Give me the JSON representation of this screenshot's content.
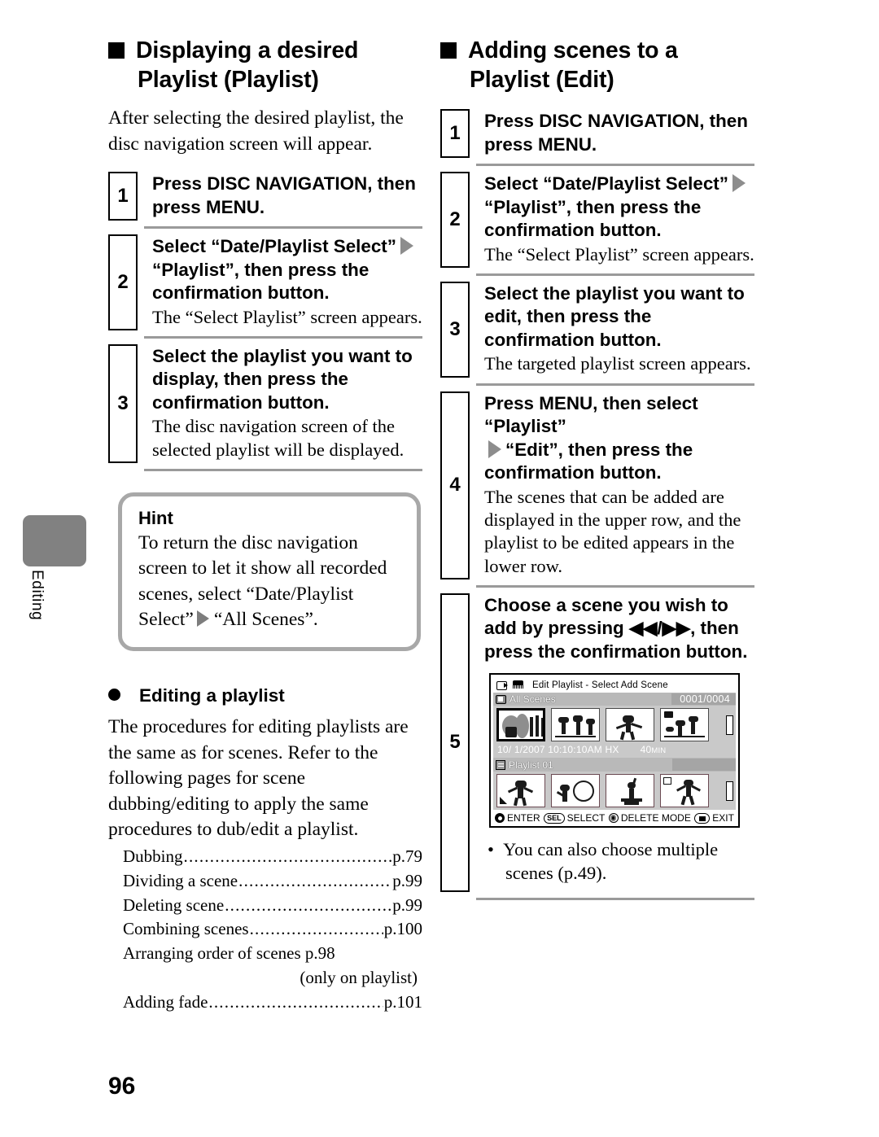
{
  "page": {
    "number": "96",
    "side_tab_label": "Editing"
  },
  "left_column": {
    "heading": "Displaying a desired Playlist (Playlist)",
    "intro": "After selecting the desired playlist, the disc navigation screen will appear.",
    "steps": [
      {
        "num": "1",
        "main_pre": "Press ",
        "main_bold": "DISC NAVIGATION",
        "main_mid": ", then press ",
        "main_bold2": "MENU",
        "main_post": ".",
        "sub": ""
      },
      {
        "num": "2",
        "main_pre": "Select “Date/Playlist Select”",
        "main_mid": "“Playlist”, then press the confirmation button.",
        "sub": "The “Select Playlist” screen appears."
      },
      {
        "num": "3",
        "main_pre": "Select the playlist you want to display, then press the confirmation button.",
        "sub": "The disc navigation screen of the selected playlist will be displayed."
      }
    ],
    "hint": {
      "title": "Hint",
      "text_before": "To return the disc navigation screen to let it show all recorded scenes, select “Date/Playlist Select”",
      "text_after": "“All Scenes”."
    },
    "subsection": {
      "heading": "Editing a playlist",
      "paragraph": "The procedures for editing playlists are the same as for scenes. Refer to the following pages for scene dubbing/editing to apply the same procedures to dub/edit a playlist.",
      "references": [
        {
          "label": "Dubbing",
          "page": "p.79"
        },
        {
          "label": "Dividing a scene",
          "page": "p.99"
        },
        {
          "label": "Deleting scene",
          "page": "p.99"
        },
        {
          "label": "Combining scenes",
          "page": "p.100"
        }
      ],
      "reference_plain": "Arranging order of scenes p.98",
      "reference_note": "(only on playlist)",
      "reference_last": {
        "label": "Adding fade",
        "page": "p.101"
      }
    }
  },
  "right_column": {
    "heading": "Adding scenes to a Playlist (Edit)",
    "steps": [
      {
        "num": "1",
        "main_pre": "Press ",
        "main_bold": "DISC NAVIGATION",
        "main_mid": ", then press ",
        "main_bold2": "MENU",
        "main_post": ".",
        "sub": ""
      },
      {
        "num": "2",
        "main_pre": "Select “Date/Playlist Select”",
        "main_mid": "“Playlist”, then press the confirmation button.",
        "sub": "The “Select Playlist” screen appears."
      },
      {
        "num": "3",
        "main_pre": "Select the playlist you want to edit, then press the confirmation button.",
        "sub": "The targeted playlist screen appears."
      },
      {
        "num": "4",
        "main_pre": "Press ",
        "main_bold": "MENU",
        "main_mid": ", then select “Playlist”",
        "main_post": "“Edit”, then press the confirmation button.",
        "sub": "The scenes that can be added are displayed in the upper row, and the playlist to be edited appears in the lower row."
      },
      {
        "num": "5",
        "main_pre": "Choose a scene you wish to add by pressing ",
        "glyph_rew": "◀◀",
        "glyph_sep": "/",
        "glyph_ff": "▶▶",
        "main_post": ", then press the confirmation button.",
        "note": "You can also choose multiple scenes (p.49)."
      }
    ],
    "lcd": {
      "title": "Edit  Playlist - Select Add Scene",
      "camera_icon": "camcorder-icon",
      "disc_icon": "disc-icon",
      "upper_row_label": "All Scenes",
      "counter": "0001/0004",
      "meta_date": "10/  1/2007",
      "meta_time": "10:10:10AM",
      "meta_quality": "HX",
      "meta_duration": "40",
      "meta_duration_unit": "MIN",
      "lower_row_label": "Playlist 01",
      "footer": [
        {
          "icon": "enter-button-icon",
          "label": "ENTER"
        },
        {
          "icon": "sel-button-icon",
          "label": "SELECT"
        },
        {
          "icon": "delete-mode-icon",
          "label": "DELETE MODE"
        },
        {
          "icon": "exit-button-icon",
          "label": "EXIT"
        }
      ]
    }
  },
  "colors": {
    "rule_gray": "#9a9a9a",
    "hint_border_gray": "#a8a8a8",
    "tab_gray": "#818181",
    "triangle_gray": "#8d8d8d",
    "lcd_band_gray": "#c9c9c9"
  }
}
